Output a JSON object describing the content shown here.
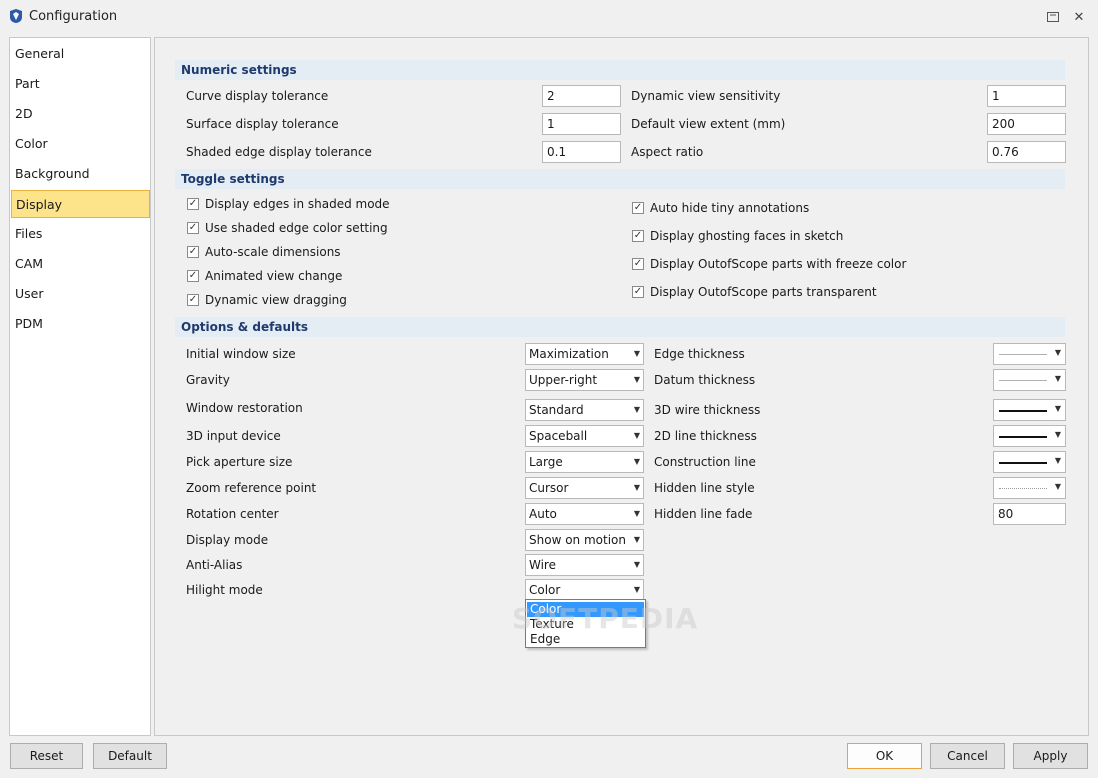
{
  "window": {
    "title": "Configuration",
    "help_icon": "help-icon",
    "close_icon": "close-icon"
  },
  "sidebar": {
    "items": [
      {
        "label": "General"
      },
      {
        "label": "Part"
      },
      {
        "label": "2D"
      },
      {
        "label": "Color"
      },
      {
        "label": "Background"
      },
      {
        "label": "Display"
      },
      {
        "label": "Files"
      },
      {
        "label": "CAM"
      },
      {
        "label": "User"
      },
      {
        "label": "PDM"
      }
    ],
    "active": "Display"
  },
  "numeric": {
    "header": "Numeric settings",
    "rows": [
      {
        "label": "Curve display tolerance",
        "value": "2"
      },
      {
        "label": "Surface display tolerance",
        "value": "1"
      },
      {
        "label": "Shaded edge display tolerance",
        "value": "0.1"
      },
      {
        "label": "Dynamic view sensitivity",
        "value": "1"
      },
      {
        "label": "Default view extent (mm)",
        "value": "200"
      },
      {
        "label": "Aspect ratio",
        "value": "0.76"
      }
    ]
  },
  "toggles": {
    "header": "Toggle settings",
    "left": [
      {
        "label": "Display edges in shaded mode",
        "checked": true
      },
      {
        "label": "Use shaded edge color setting",
        "checked": true
      },
      {
        "label": "Auto-scale dimensions",
        "checked": true
      },
      {
        "label": "Animated view change",
        "checked": true
      },
      {
        "label": "Dynamic view dragging",
        "checked": true
      }
    ],
    "right": [
      {
        "label": "Auto hide tiny annotations",
        "checked": true
      },
      {
        "label": "Display ghosting faces in sketch",
        "checked": true
      },
      {
        "label": "Display OutofScope parts with freeze color",
        "checked": true
      },
      {
        "label": "Display OutofScope parts transparent",
        "checked": true
      }
    ]
  },
  "options": {
    "header": "Options & defaults",
    "left": [
      {
        "label": "Initial window size",
        "value": "Maximization"
      },
      {
        "label": "Gravity",
        "value": "Upper-right"
      },
      {
        "label": "Window restoration",
        "value": "Standard"
      },
      {
        "label": "3D input device",
        "value": "Spaceball"
      },
      {
        "label": "Pick aperture size",
        "value": "Large"
      },
      {
        "label": "Zoom reference point",
        "value": "Cursor"
      },
      {
        "label": "Rotation center",
        "value": "Auto"
      },
      {
        "label": "Display mode",
        "value": "Show on motion"
      },
      {
        "label": "Anti-Alias",
        "value": "Wire"
      },
      {
        "label": "Hilight mode",
        "value": "Color"
      }
    ],
    "right": [
      {
        "label": "Edge thickness",
        "line": "thin-gray"
      },
      {
        "label": "Datum thickness",
        "line": "thin-gray"
      },
      {
        "label": "3D wire thickness",
        "line": "medium-black"
      },
      {
        "label": "2D line thickness",
        "line": "medium-black"
      },
      {
        "label": "Construction line",
        "line": "medium-black"
      },
      {
        "label": "Hidden line style",
        "line": "dotted-gray"
      },
      {
        "label": "Hidden line fade",
        "value": "80"
      }
    ],
    "hilight_dropdown": [
      "Color",
      "Texture",
      "Edge"
    ],
    "hilight_selected": "Color"
  },
  "watermark": "SOFTPEDIA",
  "buttons": {
    "reset": "Reset",
    "default": "Default",
    "ok": "OK",
    "cancel": "Cancel",
    "apply": "Apply"
  },
  "colors": {
    "accent_active": "#fde38a",
    "section_bg": "#e4ecf4",
    "section_text": "#1f3a6d",
    "selection": "#3399ff"
  }
}
